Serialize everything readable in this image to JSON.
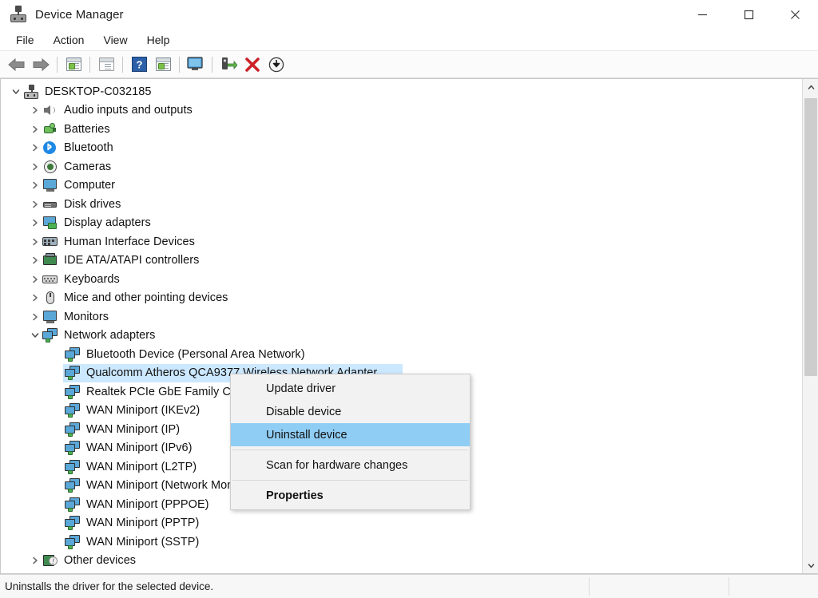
{
  "window": {
    "title": "Device Manager",
    "icon": "device-manager-icon",
    "controls": {
      "minimize": "minimize-icon",
      "maximize": "maximize-icon",
      "close": "close-icon"
    }
  },
  "menubar": {
    "items": [
      {
        "label": "File"
      },
      {
        "label": "Action"
      },
      {
        "label": "View"
      },
      {
        "label": "Help"
      }
    ]
  },
  "toolbar": {
    "buttons": [
      {
        "name": "back-icon"
      },
      {
        "name": "forward-icon"
      },
      {
        "name": "properties-icon"
      },
      {
        "name": "update-driver-window-icon"
      },
      {
        "name": "help-icon"
      },
      {
        "name": "show-hidden-devices-icon"
      },
      {
        "name": "scan-for-hardware-changes-icon"
      },
      {
        "name": "update-driver-software-icon"
      },
      {
        "name": "uninstall-device-icon"
      },
      {
        "name": "disable-device-icon"
      }
    ]
  },
  "tree": {
    "root": {
      "label": "DESKTOP-C032185",
      "icon": "computer-root-icon",
      "expanded": true
    },
    "categories": [
      {
        "label": "Audio inputs and outputs",
        "icon": "audio-icon",
        "expanded": false
      },
      {
        "label": "Batteries",
        "icon": "battery-icon",
        "expanded": false
      },
      {
        "label": "Bluetooth",
        "icon": "bluetooth-icon",
        "expanded": false
      },
      {
        "label": "Cameras",
        "icon": "camera-icon",
        "expanded": false
      },
      {
        "label": "Computer",
        "icon": "computer-icon",
        "expanded": false
      },
      {
        "label": "Disk drives",
        "icon": "disk-drive-icon",
        "expanded": false
      },
      {
        "label": "Display adapters",
        "icon": "display-adapter-icon",
        "expanded": false
      },
      {
        "label": "Human Interface Devices",
        "icon": "hid-icon",
        "expanded": false
      },
      {
        "label": "IDE ATA/ATAPI controllers",
        "icon": "ide-controller-icon",
        "expanded": false
      },
      {
        "label": "Keyboards",
        "icon": "keyboard-icon",
        "expanded": false
      },
      {
        "label": "Mice and other pointing devices",
        "icon": "mouse-icon",
        "expanded": false
      },
      {
        "label": "Monitors",
        "icon": "monitor-icon",
        "expanded": false
      },
      {
        "label": "Network adapters",
        "icon": "network-adapter-icon",
        "expanded": true
      }
    ],
    "network_devices": [
      {
        "label": "Bluetooth Device (Personal Area Network)",
        "icon": "network-device-icon",
        "selected": false
      },
      {
        "label": "Qualcomm Atheros QCA9377 Wireless Network Adapter",
        "icon": "network-device-icon",
        "selected": true
      },
      {
        "label": "Realtek PCIe GbE Family Controller",
        "icon": "network-device-icon",
        "selected": false
      },
      {
        "label": "WAN Miniport (IKEv2)",
        "icon": "network-device-icon",
        "selected": false
      },
      {
        "label": "WAN Miniport (IP)",
        "icon": "network-device-icon",
        "selected": false
      },
      {
        "label": "WAN Miniport (IPv6)",
        "icon": "network-device-icon",
        "selected": false
      },
      {
        "label": "WAN Miniport (L2TP)",
        "icon": "network-device-icon",
        "selected": false
      },
      {
        "label": "WAN Miniport (Network Monitor)",
        "icon": "network-device-icon",
        "selected": false
      },
      {
        "label": "WAN Miniport (PPPOE)",
        "icon": "network-device-icon",
        "selected": false
      },
      {
        "label": "WAN Miniport (PPTP)",
        "icon": "network-device-icon",
        "selected": false
      },
      {
        "label": "WAN Miniport (SSTP)",
        "icon": "network-device-icon",
        "selected": false
      }
    ],
    "trailing": [
      {
        "label": "Other devices",
        "icon": "other-devices-warning-icon",
        "expanded": false
      }
    ]
  },
  "context_menu": {
    "items": [
      {
        "label": "Update driver",
        "highlighted": false,
        "bold": false
      },
      {
        "label": "Disable device",
        "highlighted": false,
        "bold": false
      },
      {
        "label": "Uninstall device",
        "highlighted": true,
        "bold": false
      },
      {
        "separator": true
      },
      {
        "label": "Scan for hardware changes",
        "highlighted": false,
        "bold": false
      },
      {
        "separator": true
      },
      {
        "label": "Properties",
        "highlighted": false,
        "bold": true
      }
    ]
  },
  "statusbar": {
    "text": "Uninstalls the driver for the selected device."
  },
  "colors": {
    "selection_blue": "#cce8ff",
    "menu_highlight_blue": "#8fcdf4",
    "window_background": "#ffffff",
    "toolbar_background": "#fbfbfb",
    "statusbar_background": "#f7f7f7"
  }
}
